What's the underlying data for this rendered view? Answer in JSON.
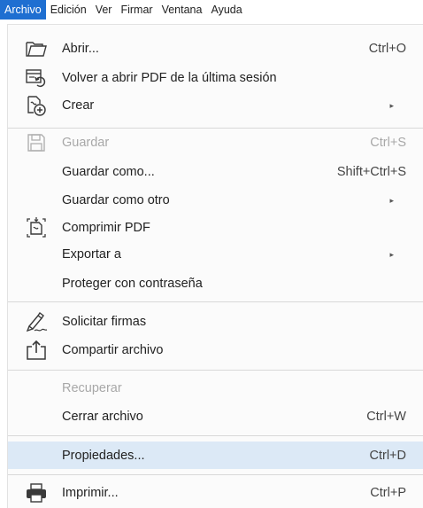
{
  "menubar": {
    "items": [
      {
        "label": "Archivo",
        "active": true
      },
      {
        "label": "Edición"
      },
      {
        "label": "Ver"
      },
      {
        "label": "Firmar"
      },
      {
        "label": "Ventana"
      },
      {
        "label": "Ayuda"
      }
    ]
  },
  "menu": {
    "items": [
      {
        "label": "Abrir...",
        "shortcut": "Ctrl+O",
        "icon": "folder-open-icon"
      },
      {
        "label": "Volver a abrir PDF de la última sesión",
        "shortcut": "",
        "icon": "reopen-session-icon"
      },
      {
        "label": "Crear",
        "shortcut": "",
        "icon": "create-pdf-icon",
        "submenu": true
      },
      {
        "label": "Guardar",
        "shortcut": "Ctrl+S",
        "icon": "save-icon",
        "disabled": true
      },
      {
        "label": "Guardar como...",
        "shortcut": "Shift+Ctrl+S"
      },
      {
        "label": "Guardar como otro",
        "shortcut": "",
        "submenu": true
      },
      {
        "label": "Comprimir PDF",
        "shortcut": "",
        "icon": "compress-pdf-icon"
      },
      {
        "label": "Exportar a",
        "shortcut": "",
        "submenu": true
      },
      {
        "label": "Proteger con contraseña",
        "shortcut": ""
      },
      {
        "label": "Solicitar firmas",
        "shortcut": "",
        "icon": "request-signature-icon"
      },
      {
        "label": "Compartir archivo",
        "shortcut": "",
        "icon": "share-icon"
      },
      {
        "label": "Recuperar",
        "shortcut": "",
        "disabled": true
      },
      {
        "label": "Cerrar archivo",
        "shortcut": "Ctrl+W"
      },
      {
        "label": "Propiedades...",
        "shortcut": "Ctrl+D",
        "highlighted": true
      },
      {
        "label": "Imprimir...",
        "shortcut": "Ctrl+P",
        "icon": "printer-icon"
      }
    ],
    "submenu_arrow": "▸"
  },
  "colors": {
    "accent": "#1f6fd1",
    "highlight": "#dce9f6",
    "disabled_text": "#a8a8a8"
  }
}
